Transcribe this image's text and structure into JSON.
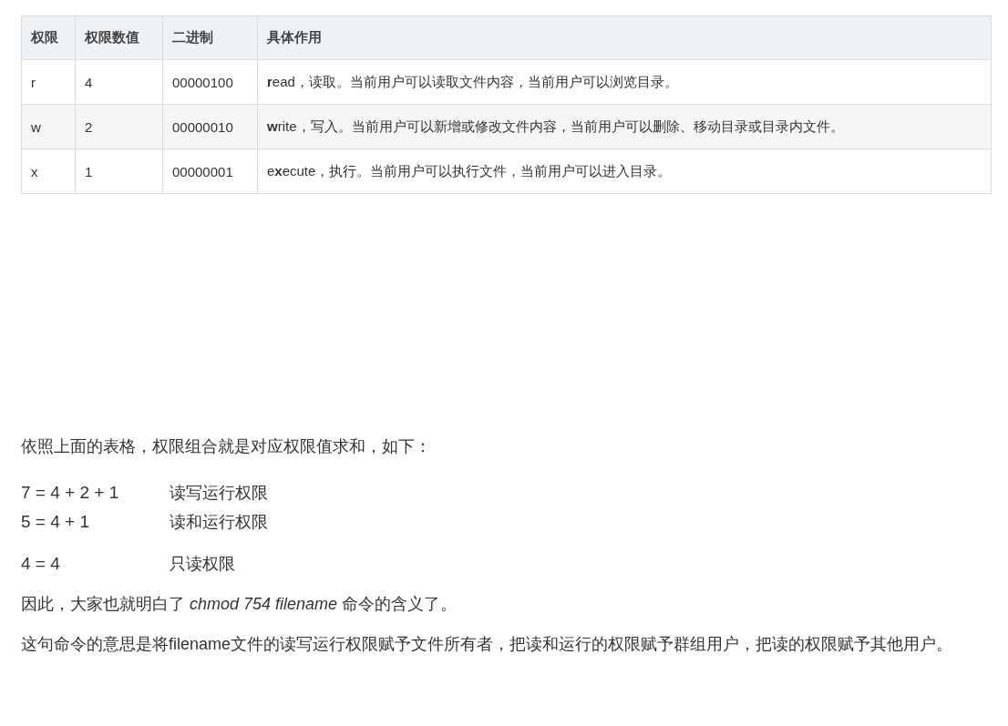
{
  "table": {
    "columns": [
      "权限",
      "权限数值",
      "二进制",
      "具体作用"
    ],
    "rows": [
      [
        "r",
        "4",
        "00000100",
        "**r**ead，读取。当前用户可以读取文件内容，当前用户可以浏览目录。"
      ],
      [
        "w",
        "2",
        "00000010",
        "**w**rite，写入。当前用户可以新增或修改文件内容，当前用户可以删除、移动目录或目录内文件。"
      ],
      [
        "x",
        "1",
        "00000001",
        "e**x**ecute，执行。当前用户可以执行文件，当前用户可以进入目录。"
      ]
    ]
  },
  "intro": "依照上面的表格，权限组合就是对应权限值求和，如下：",
  "combos": [
    [
      {
        "expr": "7 = 4 + 2 + 1",
        "meaning": "读写运行权限"
      },
      {
        "expr": "5 = 4 + 1",
        "meaning": "读和运行权限"
      }
    ],
    [
      {
        "expr": "4 = 4",
        "meaning": "只读权限"
      }
    ]
  ],
  "conclusion": "因此，大家也就明白了 *chmod  754  filename* 命令的含义了。",
  "explanation": "这句命令的意思是将filename文件的读写运行权限赋予文件所有者，把读和运行的权限赋予群组用户，把读的权限赋予其他用户。"
}
